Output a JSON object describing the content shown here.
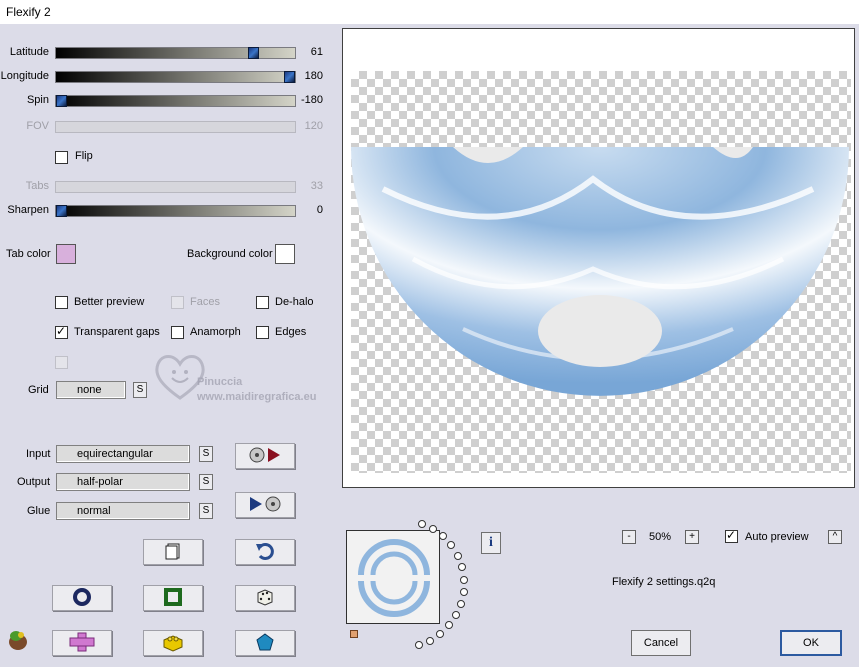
{
  "window": {
    "title": "Flexify 2"
  },
  "sliders": [
    {
      "label": "Latitude",
      "value": "61",
      "fraction": 0.84,
      "enabled": true
    },
    {
      "label": "Longitude",
      "value": "180",
      "fraction": 1.0,
      "enabled": true
    },
    {
      "label": "Spin",
      "value": "-180",
      "fraction": 0.0,
      "enabled": true
    },
    {
      "label": "FOV",
      "value": "120",
      "fraction": 0.0,
      "enabled": false
    },
    {
      "label": "Tabs",
      "value": "33",
      "fraction": 0.0,
      "enabled": false
    },
    {
      "label": "Sharpen",
      "value": "0",
      "fraction": 0.0,
      "enabled": true
    }
  ],
  "flip": {
    "label": "Flip",
    "checked": false
  },
  "colors": {
    "tab_color_label": "Tab color",
    "tab_color": "#d8b0dc",
    "background_color_label": "Background color",
    "background_color": "#ffffff"
  },
  "options": {
    "better_preview": "Better preview",
    "faces": "Faces",
    "de_halo": "De-halo",
    "transparent_gaps": "Transparent gaps",
    "anamorph": "Anamorph",
    "edges": "Edges"
  },
  "grid": {
    "label": "Grid",
    "value": "none",
    "s": "S"
  },
  "mapping": {
    "input_label": "Input",
    "input_value": "equirectangular",
    "output_label": "Output",
    "output_value": "half-polar",
    "glue_label": "Glue",
    "glue_value": "normal",
    "s": "S"
  },
  "watermark": {
    "name": "Pinuccia",
    "url": "www.maidiregrafica.eu"
  },
  "preview": {
    "zoom": "50%",
    "zoom_minus": "-",
    "zoom_plus": "+",
    "auto_preview_label": "Auto preview",
    "auto_preview_checked": true,
    "collapse": "^",
    "info": "i",
    "settings_file": "Flexify 2 settings.q2q"
  },
  "buttons": {
    "cancel": "Cancel",
    "ok": "OK"
  },
  "accent": "#2c5aa0",
  "preview_fill": "#a8c8e8"
}
